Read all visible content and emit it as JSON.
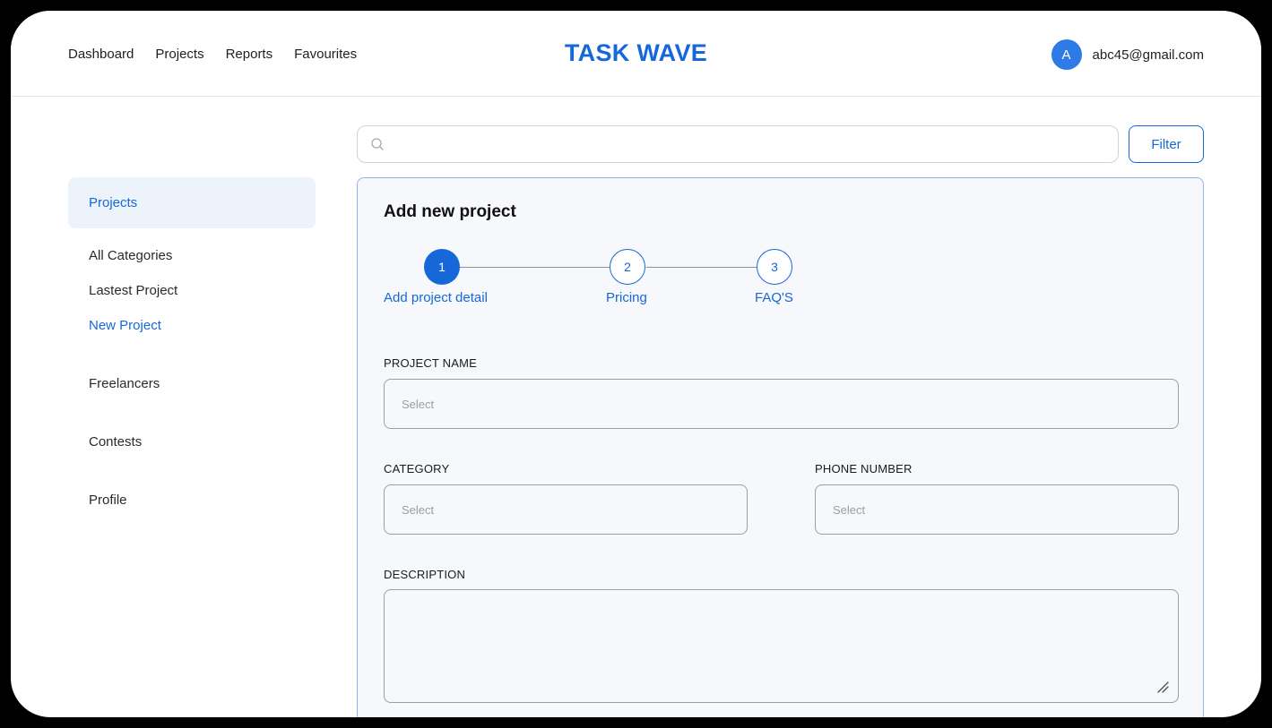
{
  "header": {
    "nav": [
      "Dashboard",
      "Projects",
      "Reports",
      "Favourites"
    ],
    "brand": "TASK WAVE",
    "avatar_initial": "A",
    "email": "abc45@gmail.com"
  },
  "sidebar": {
    "section_title": "Projects",
    "sub_items": [
      "All Categories",
      "Lastest Project",
      "New Project"
    ],
    "active_sub_item": "New Project",
    "main_items": [
      "Freelancers",
      "Contests",
      "Profile"
    ]
  },
  "search": {
    "placeholder": "",
    "filter_label": "Filter"
  },
  "form": {
    "title": "Add new project",
    "steps": [
      {
        "number": "1",
        "label": "Add project detail",
        "status": "current"
      },
      {
        "number": "2",
        "label": "Pricing",
        "status": "upcoming"
      },
      {
        "number": "3",
        "label": "FAQ'S",
        "status": "upcoming"
      }
    ],
    "project_name": {
      "label": "PROJECT NAME",
      "placeholder": "Select"
    },
    "category": {
      "label": "CATEGORY",
      "placeholder": "Select"
    },
    "phone_number": {
      "label": "PHONE NUMBER",
      "placeholder": "Select"
    },
    "description": {
      "label": "DESCRIPTION",
      "value": ""
    }
  },
  "colors": {
    "accent": "#1668d8",
    "card_border": "#8fb4e6",
    "card_background": "#f6f8fb",
    "sidebar_active_background": "#edf3fb"
  },
  "icons": [
    "search-icon",
    "resize-handle-icon"
  ]
}
